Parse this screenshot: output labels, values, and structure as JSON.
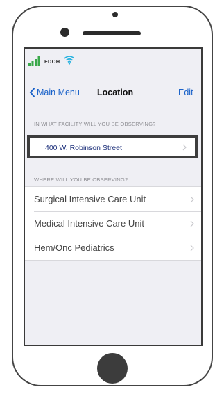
{
  "status_bar": {
    "carrier": "FDOH",
    "signal_icon": "cellular-signal-icon",
    "wifi_icon": "wifi-icon",
    "signal_color": "#3aa84a",
    "wifi_color": "#2bb3e0"
  },
  "navbar": {
    "back_label": "Main Menu",
    "back_icon": "chevron-left-icon",
    "title": "Location",
    "edit_label": "Edit",
    "accent_color": "#1a62c9"
  },
  "facility_section": {
    "header": "IN WHAT FACILITY WILL YOU BE OBSERVING?",
    "selected_facility": "400 W. Robinson Street",
    "chevron_icon": "chevron-right-icon"
  },
  "unit_section": {
    "header": "WHERE WILL YOU BE OBSERVING?",
    "items": [
      {
        "label": "Surgical Intensive Care Unit"
      },
      {
        "label": "Medical Intensive Care Unit"
      },
      {
        "label": "Hem/Onc Pediatrics"
      }
    ]
  }
}
